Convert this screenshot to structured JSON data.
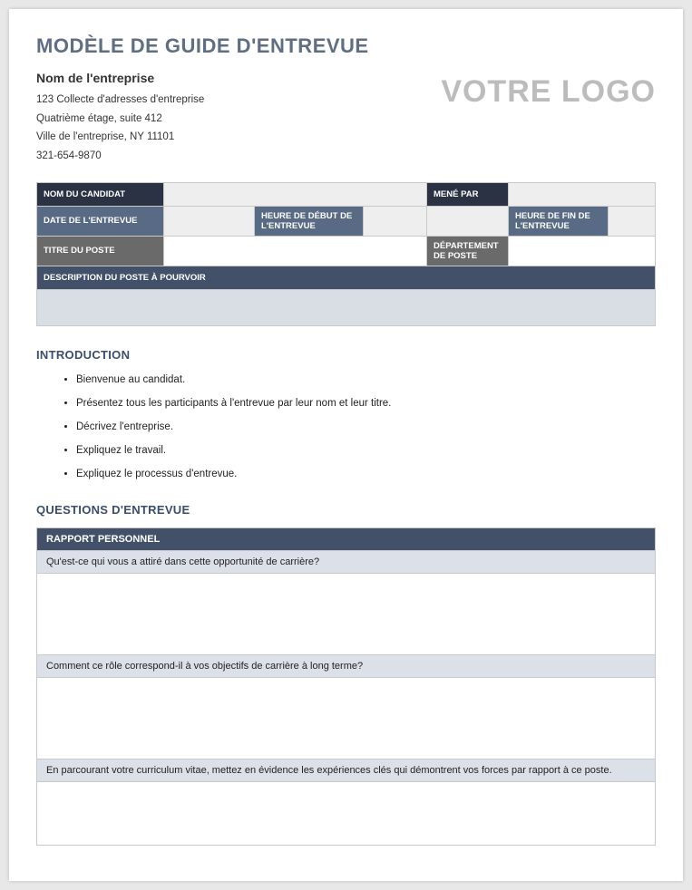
{
  "header": {
    "title": "MODÈLE DE GUIDE D'ENTREVUE",
    "company_name": "Nom de l'entreprise",
    "address1": "123 Collecte d'adresses d'entreprise",
    "address2": "Quatrième étage, suite 412",
    "address3": "Ville de l'entreprise, NY 11101",
    "phone": "321-654-9870",
    "logo": "VOTRE LOGO"
  },
  "info": {
    "candidate_label": "NOM DU CANDIDAT",
    "candidate_value": "",
    "conducted_by_label": "MENÉ PAR",
    "conducted_by_value": "",
    "date_label": "DATE DE L'ENTREVUE",
    "date_value": "",
    "start_label": "HEURE DE DÉBUT DE L'ENTREVUE",
    "start_value": "",
    "end_label": "HEURE DE FIN DE L'ENTREVUE",
    "end_value": "",
    "job_title_label": "TITRE DU POSTE",
    "job_title_value": "",
    "dept_label": "DÉPARTEMENT DE POSTE",
    "dept_value": "",
    "desc_label": "DESCRIPTION DU POSTE À POURVOIR",
    "desc_value": ""
  },
  "introduction": {
    "heading": "INTRODUCTION",
    "items": [
      "Bienvenue au candidat.",
      "Présentez tous les participants à l'entrevue par leur nom et leur titre.",
      "Décrivez l'entreprise.",
      "Expliquez le travail.",
      "Expliquez le processus d'entrevue."
    ]
  },
  "questions": {
    "heading": "QUESTIONS D'ENTREVUE",
    "section_header": "RAPPORT PERSONNEL",
    "items": [
      "Qu'est-ce qui vous a attiré dans cette opportunité de carrière?",
      "Comment ce rôle correspond-il à vos objectifs de carrière à long terme?",
      "En parcourant votre curriculum vitae, mettez en évidence les expériences clés qui démontrent vos forces par rapport à ce poste."
    ]
  }
}
